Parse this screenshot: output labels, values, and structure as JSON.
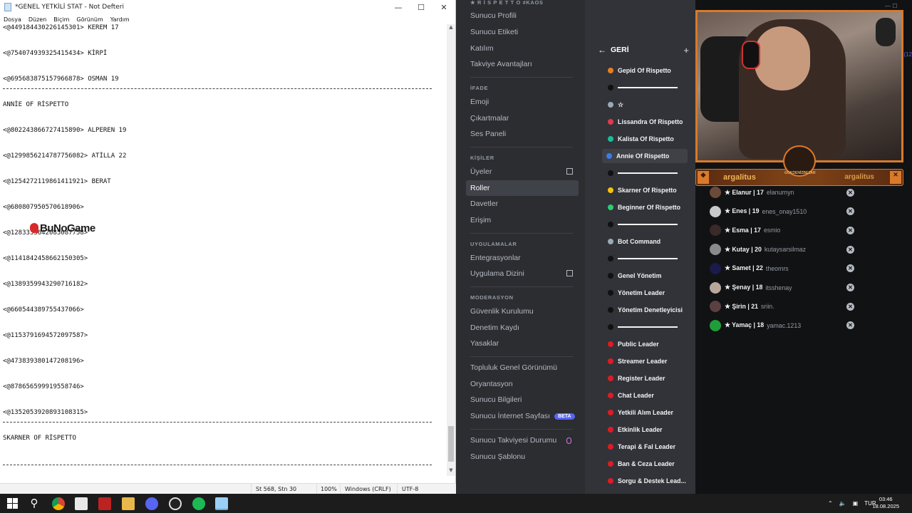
{
  "notepad": {
    "title": "*GENEL YETKİLİ STAT - Not Defteri",
    "menu": [
      "Dosya",
      "Düzen",
      "Biçim",
      "Görünüm",
      "Yardım"
    ],
    "lines": [
      "<@449184430226145301> KEREM 17",
      "<@754074939325415434> KİRPİ",
      "<@695683875157966878> OSMAN 19",
      "ANNİE OF RİSPETTO",
      "<@802243866727415890> ALPEREN 19",
      "<@1299856214787756082> ATİLLA 22",
      "<@1254272119861411921> BERAT",
      "<@680807950570618906>",
      "<@1283335642085087758>",
      "<@1141842458662150305>",
      "<@1389359943290716182>",
      "<@660544389755437066>",
      "<@1153791694572097587>",
      "<@473839380147208196>",
      "<@878656599919558746>",
      "<@1352053920893108315>",
      "SKARNER OF RİSPETTO"
    ],
    "status": {
      "position": "St 568, Stn 30",
      "zoom": "100%",
      "line_ending": "Windows (CRLF)",
      "encoding": "UTF-8"
    }
  },
  "watermark": "BuNoGame",
  "discord_settings": {
    "server_header": "★ R İ S P E T T O #KAOS",
    "items_top": [
      "Sunucu Profili",
      "Sunucu Etiketi",
      "Katılım",
      "Takviye Avantajları"
    ],
    "section_ifade": "İFADE",
    "items_ifade": [
      "Emoji",
      "Çıkartmalar",
      "Ses Paneli"
    ],
    "section_kisiler": "KİŞİLER",
    "items_kisiler": [
      "Üyeler",
      "Roller",
      "Davetler",
      "Erişim"
    ],
    "section_uygulamalar": "UYGULAMALAR",
    "items_uygulamalar": [
      "Entegrasyonlar",
      "Uygulama Dizini"
    ],
    "section_moderasyon": "MODERASYON",
    "items_moderasyon": [
      "Güvenlik Kurulumu",
      "Denetim Kaydı",
      "Yasaklar"
    ],
    "items_bottom": [
      "Topluluk Genel Görünümü",
      "Oryantasyon",
      "Sunucu Bilgileri",
      "Sunucu İnternet Sayfası"
    ],
    "beta_label": "BETA",
    "items_boost": [
      "Sunucu Takviyesi Durumu",
      "Sunucu Şablonu"
    ]
  },
  "roles_panel": {
    "back_label": "GERİ",
    "plus": "+",
    "roles": [
      {
        "name": "Gepid Of Rispetto",
        "color": "#e67e22"
      },
      {
        "name": "",
        "color": "#111111",
        "separator": true
      },
      {
        "name": "☆",
        "color": "#99aab5"
      },
      {
        "name": "Lissandra Of Rispetto",
        "color": "#e03a4e"
      },
      {
        "name": "Kalista Of Rispetto",
        "color": "#1abc9c"
      },
      {
        "name": "Annie Of Rispetto",
        "color": "#3b7be8",
        "active": true
      },
      {
        "name": "",
        "color": "#111111",
        "separator": true
      },
      {
        "name": "Skarner Of Rispetto",
        "color": "#f1c40f"
      },
      {
        "name": "Beginner Of Rispetto",
        "color": "#2ecc71"
      },
      {
        "name": "",
        "color": "#111111",
        "separator": true
      },
      {
        "name": "Bot Command",
        "color": "#99aab5"
      },
      {
        "name": "",
        "color": "#111111",
        "separator": true
      },
      {
        "name": "Genel Yönetim",
        "color": "#111111"
      },
      {
        "name": "Yönetim Leader",
        "color": "#111111"
      },
      {
        "name": "Yönetim Denetleyicisi",
        "color": "#111111"
      },
      {
        "name": "",
        "color": "#111111",
        "separator": true
      },
      {
        "name": "Public Leader",
        "color": "#e01b24"
      },
      {
        "name": "Streamer Leader",
        "color": "#e01b24"
      },
      {
        "name": "Register Leader",
        "color": "#e01b24"
      },
      {
        "name": "Chat Leader",
        "color": "#e01b24"
      },
      {
        "name": "Yetkili Alım Leader",
        "color": "#e01b24"
      },
      {
        "name": "Etkinlik Leader",
        "color": "#e01b24"
      },
      {
        "name": "Terapi & Fal Leader",
        "color": "#e01b24"
      },
      {
        "name": "Ban & Ceza Leader",
        "color": "#e01b24"
      },
      {
        "name": "Sorgu & Destek Lead...",
        "color": "#e01b24"
      }
    ]
  },
  "stream": {
    "banner_left": "argalitus",
    "banner_right": "argalitus",
    "badge_text": "GOKDENİZBEZAR",
    "edge_hint": "(12",
    "members": [
      {
        "name": "★ Elanur | 17",
        "user": "elanurnyn",
        "avatar": "#6b4a3a"
      },
      {
        "name": "★ Enes | 19",
        "user": "enes_onay1510",
        "avatar": "#c9c9c9"
      },
      {
        "name": "★ Esma | 17",
        "user": "esmio",
        "avatar": "#3a2a2a"
      },
      {
        "name": "★ Kutay | 20",
        "user": "kutaysarsilmaz",
        "avatar": "#8a8a8a"
      },
      {
        "name": "★ Samet | 22",
        "user": "theomrs",
        "avatar": "#1b1a4a"
      },
      {
        "name": "★ Şenay | 18",
        "user": "itsshenay",
        "avatar": "#b9a89a"
      },
      {
        "name": "★ Şirin | 21",
        "user": "sriin.",
        "avatar": "#5a4040"
      },
      {
        "name": "★ Yamaç | 18",
        "user": "yamac.1213",
        "avatar": "#1e9e3a"
      }
    ]
  },
  "taskbar": {
    "language": "TUR",
    "time": "03:46",
    "date": "18.08.2025"
  }
}
